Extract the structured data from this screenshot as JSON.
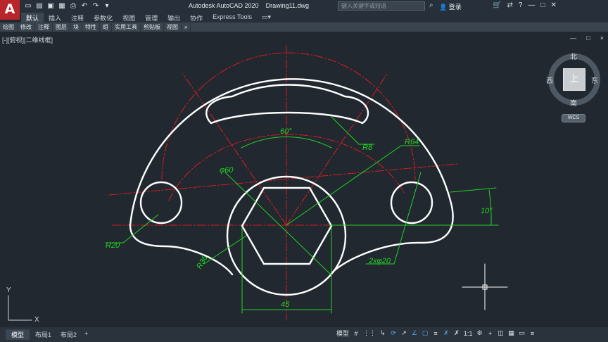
{
  "app": {
    "title": "Autodesk AutoCAD 2020",
    "document": "Drawing11.dwg",
    "logo": "A",
    "search_placeholder": "键入关键字或短语",
    "login": "登录"
  },
  "quick_access": [
    "new-icon",
    "open-icon",
    "save-icon",
    "saveas-icon",
    "plot-icon",
    "undo-icon",
    "redo-icon"
  ],
  "ribbon": {
    "tabs": [
      "默认",
      "插入",
      "注释",
      "参数化",
      "视图",
      "管理",
      "输出",
      "协作",
      "Express Tools"
    ],
    "active_tab": "默认"
  },
  "panels": [
    "绘图",
    "修改",
    "注释",
    "图层",
    "块",
    "特性",
    "组",
    "实用工具",
    "剪贴板",
    "视图",
    "»"
  ],
  "viewport": {
    "label": "[-][俯视][二维线框]",
    "controls": [
      "—",
      "□",
      "×"
    ]
  },
  "navcube": {
    "north": "北",
    "south": "南",
    "east": "东",
    "west": "西",
    "face": "上",
    "wcs": "WCS"
  },
  "dimensions": {
    "angle_60": "60°",
    "r8": "R8",
    "r64": "R64",
    "dia60": "φ60",
    "angle_10": "10°",
    "r20": "R20",
    "r36": "R36",
    "holes": "2xφ20",
    "width_45": "45"
  },
  "ucs": {
    "x": "X",
    "y": "Y"
  },
  "layout_tabs": [
    "模型",
    "布局1",
    "布局2",
    "+"
  ],
  "active_layout": "模型",
  "status": {
    "model": "模型",
    "scale": "1:1"
  },
  "colors": {
    "background": "#212830",
    "geometry": "#ffffff",
    "centerline": "#d81d1d",
    "dimension": "#22d422"
  }
}
